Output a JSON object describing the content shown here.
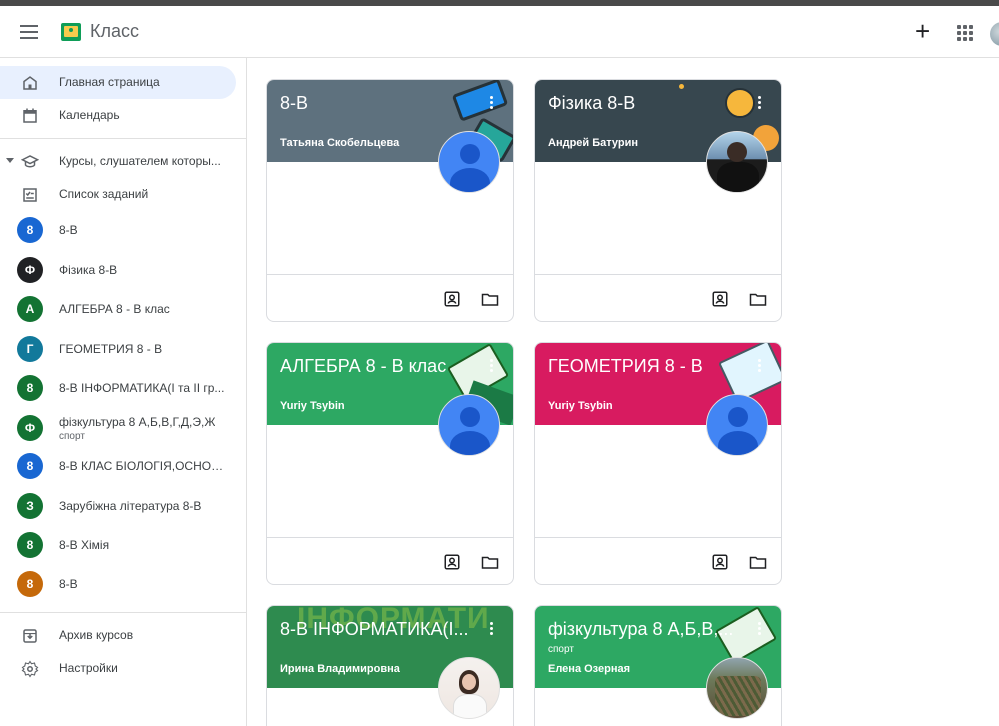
{
  "header": {
    "app_title": "Класс"
  },
  "sidebar": {
    "main": [
      {
        "label": "Главная страница",
        "icon": "home-icon"
      },
      {
        "label": "Календарь",
        "icon": "calendar-icon"
      }
    ],
    "enrolled": {
      "label": "Курсы, слушателем которы...",
      "icon": "student-cap-icon"
    },
    "todo": {
      "label": "Список заданий",
      "icon": "todo-list-icon"
    },
    "courses": [
      {
        "letter": "8",
        "label": "8-В",
        "color": "#1967d2"
      },
      {
        "letter": "Ф",
        "label": "Фізика 8-В",
        "color": "#202124"
      },
      {
        "letter": "А",
        "label": "АЛГЕБРА 8 - В клас",
        "color": "#137333"
      },
      {
        "letter": "Г",
        "label": "ГЕОМЕТРИЯ 8 - В",
        "color": "#12799b"
      },
      {
        "letter": "8",
        "label": "8-В ІНФОРМАТИКА(І та ІІ гр...",
        "color": "#137333"
      },
      {
        "letter": "Ф",
        "label": "фізкультура 8 А,Б,В,Г,Д,Э,Ж",
        "sub": "спорт",
        "color": "#137333"
      },
      {
        "letter": "8",
        "label": "8-В КЛАС БІОЛОГІЯ,ОСНОВ...",
        "color": "#1967d2"
      },
      {
        "letter": "З",
        "label": "Зарубіжна література 8-В",
        "color": "#137333"
      },
      {
        "letter": "8",
        "label": "8-В Хімія",
        "color": "#137333"
      },
      {
        "letter": "8",
        "label": "8-В",
        "color": "#c5690a"
      }
    ],
    "bottom": [
      {
        "label": "Архив курсов",
        "icon": "archive-icon"
      },
      {
        "label": "Настройки",
        "icon": "settings-icon"
      }
    ]
  },
  "cards": [
    {
      "title": "8-В",
      "section": "",
      "teacher": "Татьяна Скобельцева",
      "color": "#5e717e"
    },
    {
      "title": "Фізика 8-В",
      "section": "",
      "teacher": "Андрей Батурин",
      "color": "#37474f"
    },
    {
      "title": "АЛГЕБРА 8 - В клас",
      "section": "",
      "teacher": "Yuriy Tsybin",
      "color": "#2da863"
    },
    {
      "title": "ГЕОМЕТРИЯ 8 - В",
      "section": "",
      "teacher": "Yuriy Tsybin",
      "color": "#d81b60"
    },
    {
      "title": "8-В ІНФОРМАТИКА(І...",
      "section": "",
      "teacher": "Ирина Владимировна",
      "color": "#2e8b4f",
      "watermark": "ІНФОРМАТИ"
    },
    {
      "title": "фізкультура 8 А,Б,В,...",
      "section": "спорт",
      "teacher": "Елена Озерная",
      "color": "#2da863"
    }
  ],
  "colors": {
    "active_nav": "#e8f0fe",
    "divider": "#e0e0e0"
  }
}
